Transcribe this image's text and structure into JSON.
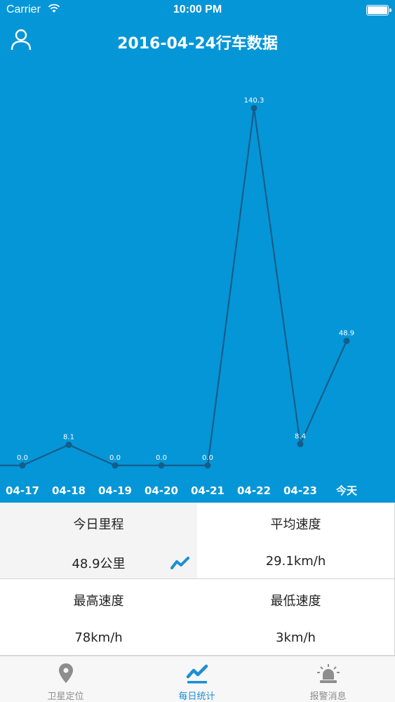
{
  "status_bar": {
    "carrier": "Carrier",
    "time": "10:00 PM"
  },
  "header": {
    "title": "2016-04-24行车数据"
  },
  "chart_data": {
    "type": "line",
    "categories": [
      "04-17",
      "04-18",
      "04-19",
      "04-20",
      "04-21",
      "04-22",
      "04-23",
      "今天"
    ],
    "values": [
      0.0,
      8.1,
      0.0,
      0.0,
      0.0,
      140.3,
      8.4,
      48.9
    ],
    "value_labels": [
      "0.0",
      "8.1",
      "0.0",
      "0.0",
      "0.0",
      "140.3",
      "8.4",
      "48.9"
    ],
    "ylim": [
      0,
      140.3
    ],
    "grid": false,
    "line_color": "#155d8a"
  },
  "stats": {
    "mileage": {
      "label": "今日里程",
      "value": "48.9公里"
    },
    "avg_speed": {
      "label": "平均速度",
      "value": "29.1km/h"
    },
    "max_speed": {
      "label": "最高速度",
      "value": "78km/h"
    },
    "min_speed": {
      "label": "最低速度",
      "value": "3km/h"
    }
  },
  "tabs": [
    {
      "label": "卫星定位",
      "icon": "location-pin-icon"
    },
    {
      "label": "每日统计",
      "icon": "trend-chart-icon"
    },
    {
      "label": "报警消息",
      "icon": "alarm-light-icon"
    }
  ],
  "colors": {
    "primary": "#0596d7",
    "accent": "#1a8fd3",
    "tab_inactive": "#8e8e8e"
  }
}
